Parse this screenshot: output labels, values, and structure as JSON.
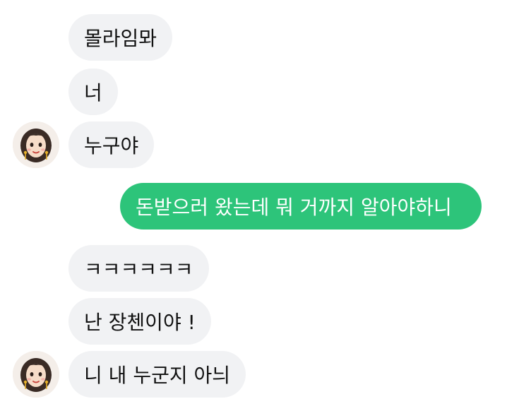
{
  "chat": {
    "messages": [
      {
        "direction": "incoming",
        "text": "몰라임뫄"
      },
      {
        "direction": "incoming",
        "text": "너"
      },
      {
        "direction": "incoming",
        "text": "누구야"
      },
      {
        "direction": "outgoing",
        "text": "돈받으러 왔는데 뭐 거까지 알아야하니"
      },
      {
        "direction": "incoming",
        "text": "ㅋㅋㅋㅋㅋㅋ"
      },
      {
        "direction": "incoming",
        "text": "난 장첸이야 !"
      },
      {
        "direction": "incoming",
        "text": "니 내 누군지 아늬"
      }
    ]
  },
  "colors": {
    "incoming_bubble": "#f1f2f4",
    "outgoing_bubble": "#2dc47a",
    "outgoing_text": "#ffffff",
    "incoming_text": "#111111"
  },
  "icons": {
    "avatar": "sender-avatar"
  }
}
